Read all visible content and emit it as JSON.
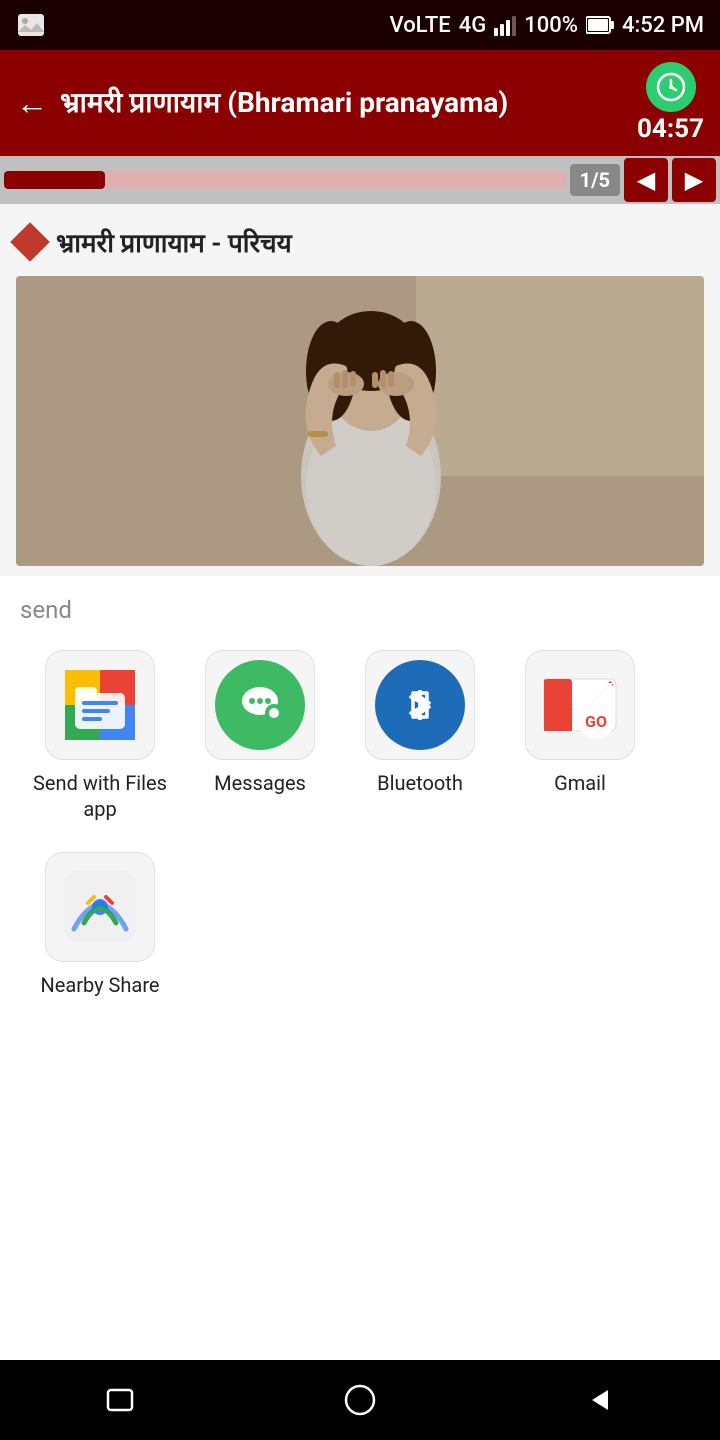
{
  "statusBar": {
    "volte": "VoLTE",
    "signal": "4G",
    "battery": "100%",
    "time": "4:52 PM"
  },
  "header": {
    "backLabel": "←",
    "title": "भ्रामरी प्राणायाम (Bhramari pranayama)",
    "timerIcon": "⏱",
    "timerValue": "04:57"
  },
  "progress": {
    "fillPercent": 18,
    "label": "1/5"
  },
  "content": {
    "sectionTitle": "भ्रामरी प्राणायाम - परिचय"
  },
  "shareSheet": {
    "title": "send",
    "items": [
      {
        "id": "files",
        "label": "Send with Files app"
      },
      {
        "id": "messages",
        "label": "Messages"
      },
      {
        "id": "bluetooth",
        "label": "Bluetooth"
      },
      {
        "id": "gmail",
        "label": "Gmail"
      },
      {
        "id": "nearby",
        "label": "Nearby Share"
      }
    ]
  },
  "navigation": {
    "prevLabel": "◀",
    "nextLabel": "▶"
  }
}
